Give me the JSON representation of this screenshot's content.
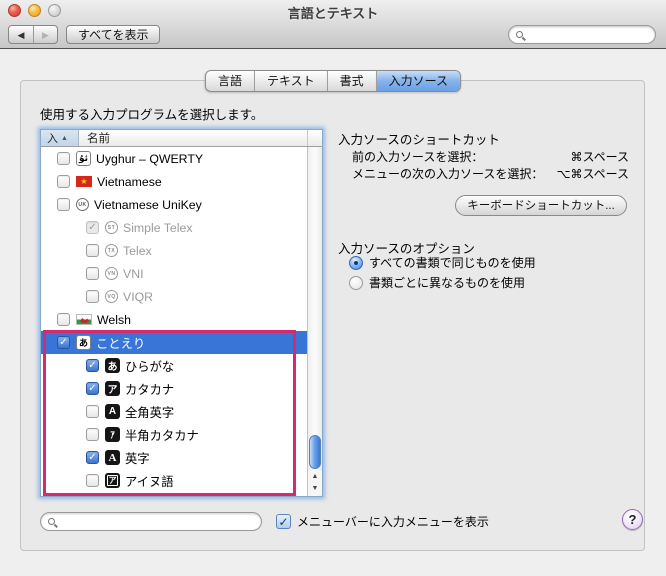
{
  "titlebar": {
    "title": "言語とテキスト"
  },
  "toolbar": {
    "back_glyph": "◀",
    "forward_glyph": "▶",
    "show_all_label": "すべてを表示",
    "search_placeholder": ""
  },
  "tabs": [
    {
      "label": "言語",
      "selected": false
    },
    {
      "label": "テキスト",
      "selected": false
    },
    {
      "label": "書式",
      "selected": false
    },
    {
      "label": "入力ソース",
      "selected": true
    }
  ],
  "content": {
    "instruction": "使用する入力プログラムを選択します。",
    "list": {
      "header": {
        "enabled_column": "入",
        "sort_indicator": "▲",
        "name_column": "名前"
      },
      "rows": [
        {
          "name": "Uyghur – QWERTY",
          "checked": false,
          "disabled": false,
          "selected": false,
          "indent": 0,
          "icon": {
            "name": "uyghur-icon",
            "type": "light-square",
            "text": "ئۇ"
          }
        },
        {
          "name": "Vietnamese",
          "checked": false,
          "disabled": false,
          "selected": false,
          "indent": 0,
          "icon": {
            "name": "vietnam-flag-icon",
            "type": "flag-vietnam",
            "text": "★"
          }
        },
        {
          "name": "Vietnamese UniKey",
          "checked": false,
          "disabled": false,
          "selected": false,
          "indent": 0,
          "icon": {
            "name": "unikey-icon",
            "type": "circle",
            "text": "UK"
          }
        },
        {
          "name": "Simple Telex",
          "checked": true,
          "disabled": true,
          "selected": false,
          "indent": 1,
          "icon": {
            "name": "simple-telex-icon",
            "type": "circle",
            "text": "ST"
          }
        },
        {
          "name": "Telex",
          "checked": false,
          "disabled": true,
          "selected": false,
          "indent": 1,
          "icon": {
            "name": "telex-icon",
            "type": "circle",
            "text": "TX"
          }
        },
        {
          "name": "VNI",
          "checked": false,
          "disabled": true,
          "selected": false,
          "indent": 1,
          "icon": {
            "name": "vni-icon",
            "type": "circle",
            "text": "VN"
          }
        },
        {
          "name": "VIQR",
          "checked": false,
          "disabled": true,
          "selected": false,
          "indent": 1,
          "icon": {
            "name": "viqr-icon",
            "type": "circle",
            "text": "VQ"
          }
        },
        {
          "name": "Welsh",
          "checked": false,
          "disabled": false,
          "selected": false,
          "indent": 0,
          "icon": {
            "name": "welsh-flag-icon",
            "type": "flag-welsh",
            "text": ""
          }
        },
        {
          "name": "ことえり",
          "checked": true,
          "disabled": false,
          "selected": true,
          "indent": 0,
          "icon": {
            "name": "kotoeri-icon",
            "type": "light-square",
            "text": "あ"
          }
        },
        {
          "name": "ひらがな",
          "checked": true,
          "disabled": false,
          "selected": false,
          "indent": 1,
          "icon": {
            "name": "hiragana-icon",
            "type": "dark-square",
            "text": "あ"
          }
        },
        {
          "name": "カタカナ",
          "checked": true,
          "disabled": false,
          "selected": false,
          "indent": 1,
          "icon": {
            "name": "katakana-icon",
            "type": "dark-square",
            "text": "ア"
          }
        },
        {
          "name": "全角英字",
          "checked": false,
          "disabled": false,
          "selected": false,
          "indent": 1,
          "icon": {
            "name": "fullwidth-roman-icon",
            "type": "dark-square",
            "text": "A"
          }
        },
        {
          "name": "半角カタカナ",
          "checked": false,
          "disabled": false,
          "selected": false,
          "indent": 1,
          "icon": {
            "name": "halfwidth-katakana-icon",
            "type": "dark-square-narrow",
            "text": "ｱ"
          }
        },
        {
          "name": "英字",
          "checked": true,
          "disabled": false,
          "selected": false,
          "indent": 1,
          "icon": {
            "name": "romaji-icon",
            "type": "dark-square-serif",
            "text": "A"
          }
        },
        {
          "name": "アイヌ語",
          "checked": false,
          "disabled": false,
          "selected": false,
          "indent": 1,
          "icon": {
            "name": "ainu-icon",
            "type": "dark-square-outline",
            "text": "ア"
          }
        }
      ]
    },
    "shortcuts": {
      "title": "入力ソースのショートカット",
      "items": [
        {
          "label": "前の入力ソースを選択：",
          "value": "⌘スペース"
        },
        {
          "label": "メニューの次の入力ソースを選択：",
          "value": "⌥⌘スペース"
        }
      ],
      "button_label": "キーボードショートカット..."
    },
    "options": {
      "title": "入力ソースのオプション",
      "items": [
        {
          "label": "すべての書類で同じものを使用",
          "selected": true
        },
        {
          "label": "書類ごとに異なるものを使用",
          "selected": false
        }
      ]
    },
    "footer": {
      "search_placeholder": "",
      "menu_checkbox_label": "メニューバーに入力メニューを表示",
      "menu_checkbox_checked": true,
      "help_label": "?"
    }
  },
  "glyphs": {
    "check": "✓",
    "scroll_up": "▲",
    "scroll_down": "▼"
  },
  "annotation": {
    "highlight_color": "#d42a6e"
  },
  "colors": {
    "selection_blue": "#3875d7",
    "tab_selected_blue": "#86b2ec",
    "focus_ring": "#74a9e6"
  }
}
